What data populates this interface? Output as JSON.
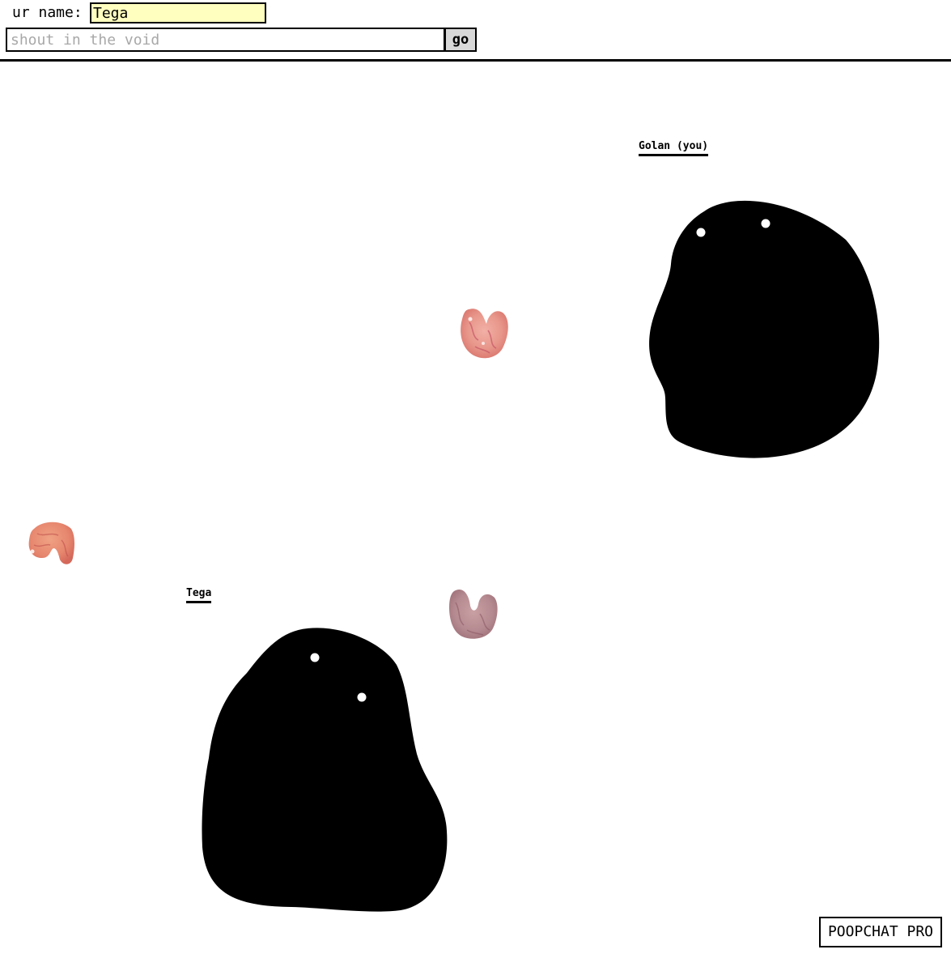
{
  "controls": {
    "name_label": "ur name:",
    "name_value": "Tega",
    "message_placeholder": "shout in the void",
    "message_value": "",
    "send_label": "go"
  },
  "players": [
    {
      "label": "Golan (you)",
      "icon": "blob-avatar-icon",
      "color": "#000000"
    },
    {
      "label": "Tega",
      "icon": "blob-avatar-icon",
      "color": "#000000"
    }
  ],
  "items": [
    {
      "icon": "pink-treat-icon"
    },
    {
      "icon": "pink-treat-icon"
    },
    {
      "icon": "pink-treat-icon"
    }
  ],
  "colors": {
    "name_field_bg": "#ffffc0",
    "button_bg": "#d8d8d8",
    "treat_primary": "#e8968a",
    "treat_secondary": "#b58a90"
  },
  "brand": {
    "label": "POOPCHAT PRO"
  }
}
